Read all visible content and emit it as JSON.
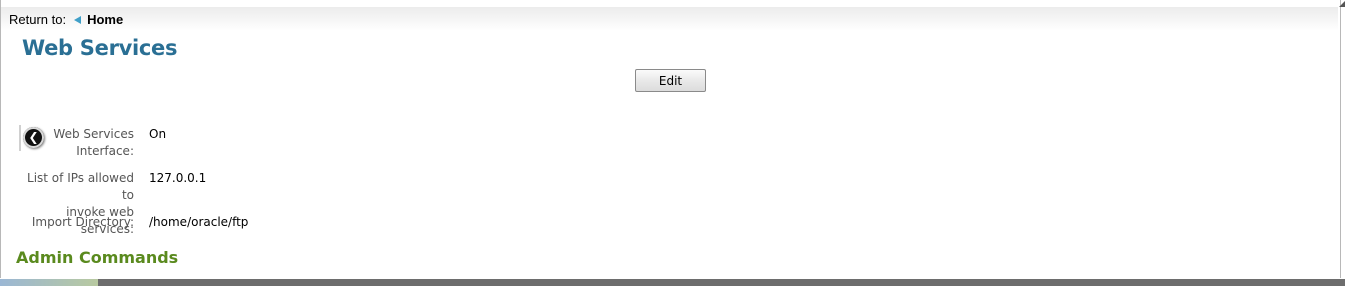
{
  "breadcrumb": {
    "return_label": "Return to:",
    "home_label": "Home"
  },
  "page": {
    "title": "Web Services"
  },
  "toolbar": {
    "edit_label": "Edit"
  },
  "fields": [
    {
      "label_line1": "Web Services",
      "label_line2": "Interface:",
      "value": "On"
    },
    {
      "label_line1": "List of IPs allowed to",
      "label_line2": "invoke web services:",
      "value": "127.0.0.1"
    },
    {
      "label_line1": "Import Directory:",
      "label_line2": "",
      "value": "/home/oracle/ftp"
    }
  ],
  "sections": {
    "admin_commands": "Admin Commands"
  },
  "icons": {
    "back": "chevron-left-icon",
    "home": "triangle-left-icon"
  },
  "colors": {
    "title": "#2a6f94",
    "admin_heading": "#5a8a1e",
    "breadcrumb_arrow": "#3f9fc8"
  }
}
